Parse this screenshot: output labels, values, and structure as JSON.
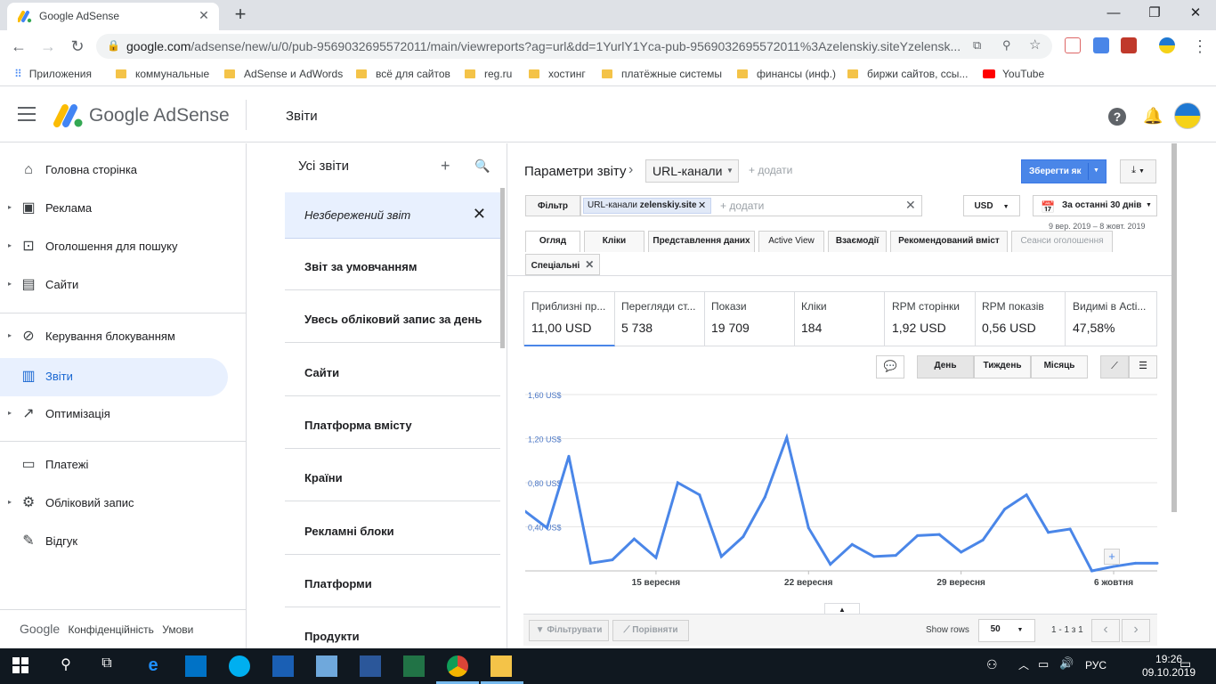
{
  "browser": {
    "tab_title": "Google AdSense",
    "url_host": "google.com",
    "url_path": "/adsense/new/u/0/pub-9569032695572011/main/viewreports?ag=url&dd=1YurlY1Yca-pub-9569032695572011%3Azelenskiy.siteYzelensk...",
    "bookmarks": [
      "Приложения",
      "коммунальные",
      "AdSense и AdWords",
      "всё для сайтов",
      "reg.ru",
      "хостинг",
      "платёжные системы",
      "финансы (инф.)",
      "биржи сайтов, ссы...",
      "YouTube"
    ]
  },
  "header": {
    "brand": "Google AdSense",
    "section_title": "Звіти"
  },
  "leftnav": {
    "items": [
      {
        "label": "Головна сторінка",
        "icon": "home-icon"
      },
      {
        "label": "Реклама",
        "icon": "ads-icon"
      },
      {
        "label": "Оголошення для пошуку",
        "icon": "search-ads-icon"
      },
      {
        "label": "Сайти",
        "icon": "sites-icon"
      },
      {
        "label": "Керування блокуванням",
        "icon": "block-icon"
      },
      {
        "label": "Звіти",
        "icon": "reports-icon"
      },
      {
        "label": "Оптимізація",
        "icon": "optimization-icon"
      },
      {
        "label": "Платежі",
        "icon": "payments-icon"
      },
      {
        "label": "Обліковий запис",
        "icon": "gear-icon"
      },
      {
        "label": "Відгук",
        "icon": "feedback-icon"
      }
    ],
    "footer": {
      "google": "Google",
      "privacy": "Конфіденційність",
      "terms": "Умови"
    }
  },
  "reports": {
    "title": "Усі звіти",
    "items": [
      "Незбережений звіт",
      "Звіт за умовчанням",
      "Увесь обліковий запис за день",
      "Сайти",
      "Платформа вмісту",
      "Країни",
      "Рекламні блоки",
      "Платформи",
      "Продукти"
    ]
  },
  "main": {
    "params_label": "Параметри звіту",
    "dimension": "URL-канали",
    "add_label": "+ додати",
    "save_button": "Зберегти як",
    "filter_label": "Фільтр",
    "chip_label": "URL-канали",
    "chip_value": "zelenskiy.site",
    "filter_add": "+ додати",
    "currency": "USD",
    "date_range": "За останні 30 днів",
    "date_sub": "9 вер. 2019 – 8 жовт. 2019",
    "tabs": [
      "Огляд",
      "Кліки",
      "Представлення даних",
      "Active View",
      "Взаємодії",
      "Рекомендований вміст",
      "Сеанси оголошення",
      "Спеціальні"
    ],
    "metrics": [
      {
        "name": "Приблизні пр...",
        "value": "11,00 USD"
      },
      {
        "name": "Перегляди ст...",
        "value": "5 738"
      },
      {
        "name": "Покази",
        "value": "19 709"
      },
      {
        "name": "Кліки",
        "value": "184"
      },
      {
        "name": "RPM сторінки",
        "value": "1,92 USD"
      },
      {
        "name": "RPM показів",
        "value": "0,56 USD"
      },
      {
        "name": "Видимі в Acti...",
        "value": "47,58%"
      }
    ],
    "period": [
      "День",
      "Тиждень",
      "Місяць"
    ],
    "bottom": {
      "filter_btn": "Фільтрувати",
      "compare_btn": "Порівняти",
      "show_rows": "Show rows",
      "rows_value": "50",
      "pagination": "1 - 1 з 1"
    }
  },
  "chart_data": {
    "type": "line",
    "x": [
      "9 вер",
      "10 вер",
      "11 вер",
      "12 вер",
      "13 вер",
      "14 вер",
      "15 вер",
      "16 вер",
      "17 вер",
      "18 вер",
      "19 вер",
      "20 вер",
      "21 вер",
      "22 вер",
      "23 вер",
      "24 вер",
      "25 вер",
      "26 вер",
      "27 вер",
      "28 вер",
      "29 вер",
      "30 вер",
      "1 жовт",
      "2 жовт",
      "3 жовт",
      "4 жовт",
      "5 жовт",
      "6 жовт",
      "7 жовт",
      "8 жовт"
    ],
    "series": [
      {
        "values": [
          0.54,
          0.39,
          1.04,
          0.07,
          0.1,
          0.29,
          0.12,
          0.8,
          0.69,
          0.13,
          0.31,
          0.67,
          1.21,
          0.39,
          0.06,
          0.24,
          0.13,
          0.14,
          0.32,
          0.33,
          0.17,
          0.28,
          0.56,
          0.69,
          0.35,
          0.38,
          0.0,
          0.04,
          0.07,
          0.07
        ]
      }
    ],
    "y_ticks": [
      "1,60 US$",
      "1,20 US$",
      "0,80 US$",
      "0,40 US$"
    ],
    "x_ticks": [
      "15 вересня",
      "22 вересня",
      "29 вересня",
      "6 жовтня"
    ],
    "ylim": [
      0,
      1.6
    ],
    "grid": true,
    "color": "#4a86e8"
  },
  "taskbar": {
    "lang": "РУС",
    "time": "19:26",
    "date": "09.10.2019"
  }
}
